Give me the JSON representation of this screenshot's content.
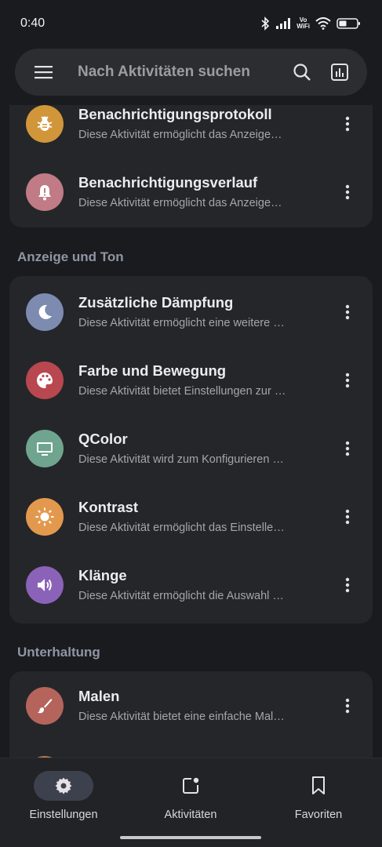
{
  "status_bar": {
    "time": "0:40",
    "vowifi_top": "Vo",
    "vowifi_bottom": "WiFi"
  },
  "search": {
    "placeholder": "Nach Aktivitäten suchen"
  },
  "sections": [
    {
      "title": "",
      "items": [
        {
          "title": "Benachrichtigungsprotokoll",
          "subtitle": "Diese Aktivität ermöglicht das Anzeige…",
          "icon": "bug-icon",
          "color": "#d1963a"
        },
        {
          "title": "Benachrichtigungsverlauf",
          "subtitle": "Diese Aktivität ermöglicht das Anzeige…",
          "icon": "bell-icon",
          "color": "#c07b86"
        }
      ]
    },
    {
      "title": "Anzeige und Ton",
      "items": [
        {
          "title": "Zusätzliche Dämpfung",
          "subtitle": "Diese Aktivität ermöglicht eine weitere …",
          "icon": "moon-icon",
          "color": "#7d8bb1"
        },
        {
          "title": "Farbe und Bewegung",
          "subtitle": "Diese Aktivität bietet Einstellungen zur …",
          "icon": "palette-icon",
          "color": "#b9474f"
        },
        {
          "title": "QColor",
          "subtitle": "Diese Aktivität wird zum Konfigurieren …",
          "icon": "monitor-icon",
          "color": "#6fa58f"
        },
        {
          "title": "Kontrast",
          "subtitle": "Diese Aktivität ermöglicht das Einstelle…",
          "icon": "sun-icon",
          "color": "#e3994d"
        },
        {
          "title": "Klänge",
          "subtitle": "Diese Aktivität ermöglicht die Auswahl …",
          "icon": "speaker-icon",
          "color": "#8a63b9"
        }
      ]
    },
    {
      "title": "Unterhaltung",
      "items": [
        {
          "title": "Malen",
          "subtitle": "Diese Aktivität bietet eine einfache Mal…",
          "icon": "brush-icon",
          "color": "#b5645c"
        }
      ]
    }
  ],
  "bottom_nav": [
    {
      "label": "Einstellungen",
      "icon": "gear-icon",
      "active": true
    },
    {
      "label": "Aktivitäten",
      "icon": "activity-icon",
      "active": false
    },
    {
      "label": "Favoriten",
      "icon": "bookmark-icon",
      "active": false
    }
  ]
}
